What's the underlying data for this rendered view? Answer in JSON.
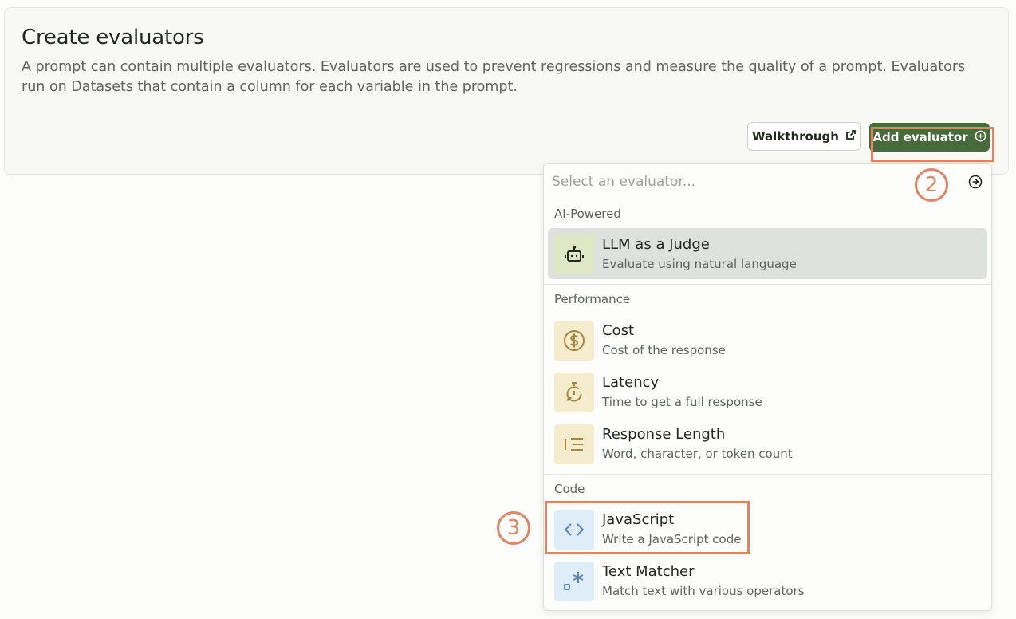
{
  "card": {
    "title": "Create evaluators",
    "description": "A prompt can contain multiple evaluators. Evaluators are used to prevent regressions and measure the quality of a prompt. Evaluators run on Datasets that contain a column for each variable in the prompt.",
    "walkthrough_label": "Walkthrough",
    "add_evaluator_label": "Add evaluator"
  },
  "dropdown": {
    "search_placeholder": "Select an evaluator...",
    "groups": [
      {
        "label": "AI-Powered",
        "items": [
          {
            "title": "LLM as a Judge",
            "subtitle": "Evaluate using natural language",
            "icon": "robot-icon",
            "active": true
          }
        ]
      },
      {
        "label": "Performance",
        "items": [
          {
            "title": "Cost",
            "subtitle": "Cost of the response",
            "icon": "dollar-icon"
          },
          {
            "title": "Latency",
            "subtitle": "Time to get a full response",
            "icon": "timer-icon"
          },
          {
            "title": "Response Length",
            "subtitle": "Word, character, or token count",
            "icon": "text-length-icon"
          }
        ]
      },
      {
        "label": "Code",
        "items": [
          {
            "title": "JavaScript",
            "subtitle": "Write a JavaScript code",
            "icon": "code-icon"
          },
          {
            "title": "Text Matcher",
            "subtitle": "Match text with various operators",
            "icon": "regex-icon"
          }
        ]
      }
    ]
  },
  "annotations": {
    "step2": "2",
    "step3": "3"
  },
  "colors": {
    "accent": "#486b3c",
    "highlight": "#df8566"
  }
}
